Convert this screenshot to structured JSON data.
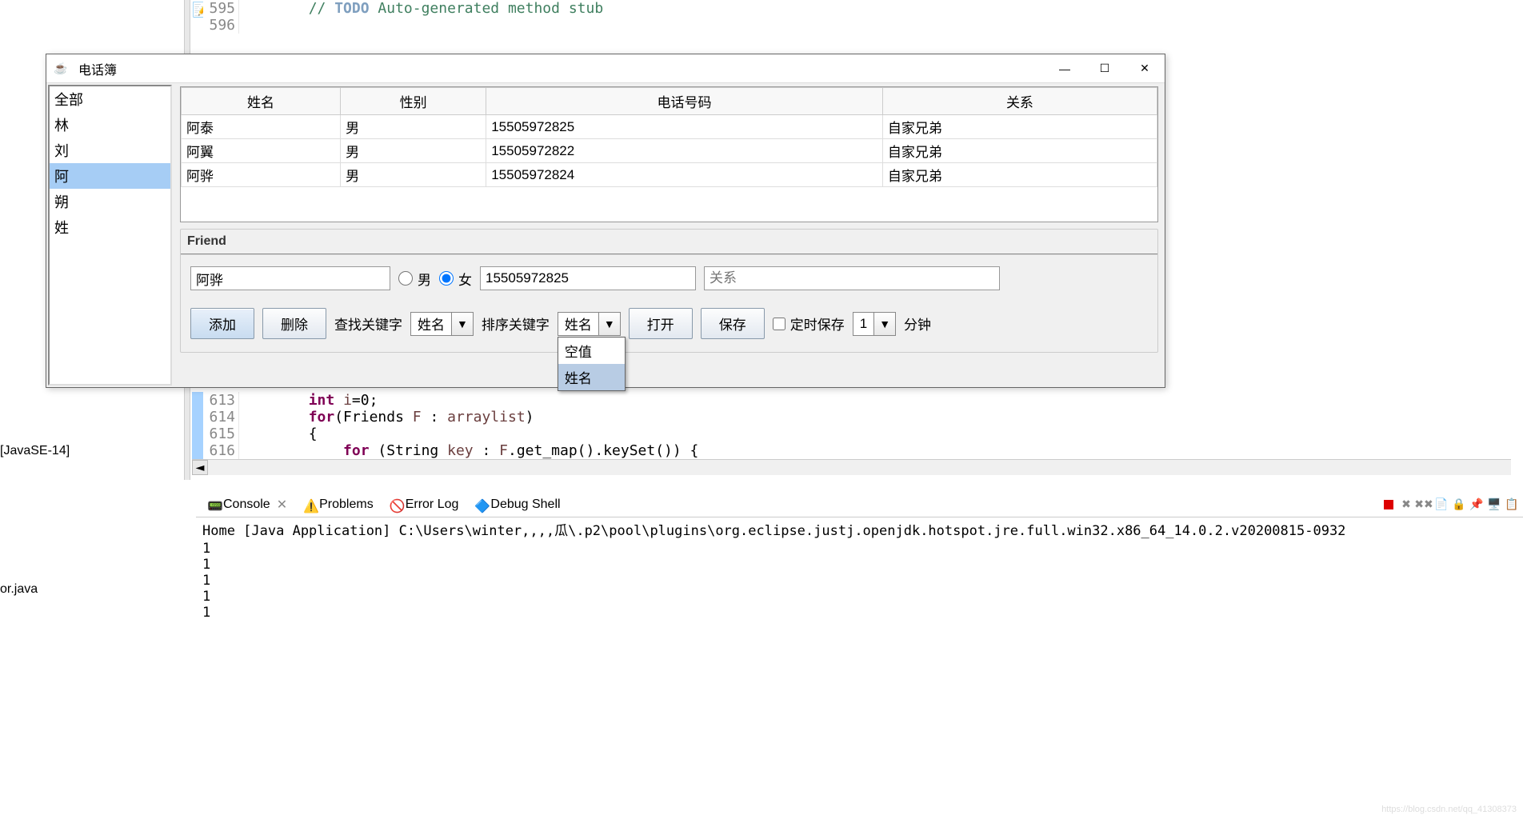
{
  "eclipse": {
    "lines_top": [
      {
        "num": "595",
        "marker": true,
        "code": "        // ",
        "todo_kw": "TODO ",
        "todo_rest": "Auto-generated method stub"
      },
      {
        "num": "596",
        "marker": false,
        "code": ""
      }
    ],
    "lines_below": [
      {
        "num": "613",
        "blue": true,
        "code": "        int ",
        "rest": "i=0;",
        "kw": "int"
      },
      {
        "num": "614",
        "blue": true,
        "kw": "for",
        "code": "        for",
        "rest": "(Friends F : arraylist)"
      },
      {
        "num": "615",
        "blue": true,
        "code": "        {",
        "rest": ""
      },
      {
        "num": "616",
        "blue": true,
        "kw": "for",
        "code": "            for ",
        "rest": "(String key : F.get_map().keySet()) {"
      }
    ],
    "left_tree_item": "[JavaSE-14]",
    "left_file": "or.java"
  },
  "dialog": {
    "title": "电话簿",
    "sidebar": {
      "items": [
        "全部",
        "林",
        "刘",
        "阿",
        "朔",
        "姓"
      ],
      "selected_index": 3
    },
    "table": {
      "headers": [
        "姓名",
        "性别",
        "电话号码",
        "关系"
      ],
      "rows": [
        [
          "阿泰",
          "男",
          "15505972825",
          "自家兄弟"
        ],
        [
          "阿翼",
          "男",
          "15505972822",
          "自家兄弟"
        ],
        [
          "阿骅",
          "男",
          "15505972824",
          "自家兄弟"
        ]
      ]
    },
    "friend": {
      "title": "Friend",
      "name": "阿骅",
      "gender_male": "男",
      "gender_female": "女",
      "phone": "15505972825",
      "relation_placeholder": "关系"
    },
    "toolbar": {
      "add": "添加",
      "delete": "删除",
      "search_label": "查找关键字",
      "search_combo": "姓名",
      "sort_label": "排序关键字",
      "sort_combo": "姓名",
      "sort_options": [
        "空值",
        "姓名"
      ],
      "open": "打开",
      "save": "保存",
      "auto_save": "定时保存",
      "minutes_val": "1",
      "minutes_label": "分钟"
    }
  },
  "console": {
    "tabs": [
      "Console",
      "Problems",
      "Error Log",
      "Debug Shell"
    ],
    "close_x": "✕",
    "launch_text": "Home [Java Application] C:\\Users\\winter,,,,瓜\\.p2\\pool\\plugins\\org.eclipse.justj.openjdk.hotspot.jre.full.win32.x86_64_14.0.2.v20200815-0932",
    "output": [
      "1",
      "1",
      "1",
      "1",
      "1"
    ]
  },
  "watermark": "https://blog.csdn.net/qq_41308373"
}
